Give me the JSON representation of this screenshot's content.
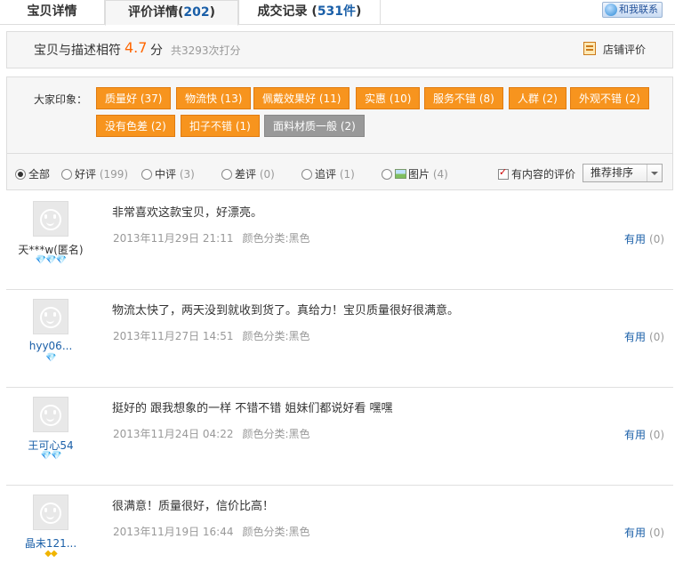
{
  "tabs": [
    {
      "label": "宝贝详情",
      "count": ""
    },
    {
      "label": "评价详情",
      "count": "202"
    },
    {
      "label": "成交记录",
      "count": "531件"
    }
  ],
  "contact_label": "和我联系",
  "rating": {
    "label": "宝贝与描述相符",
    "score": "4.7",
    "unit": "分",
    "count_text": "共3293次打分",
    "shop_review": "店铺评价"
  },
  "impressions": {
    "label": "大家印象：",
    "tags": [
      {
        "text": "质量好 (37)",
        "type": "positive"
      },
      {
        "text": "物流快 (13)",
        "type": "positive"
      },
      {
        "text": "佩戴效果好 (11)",
        "type": "positive"
      },
      {
        "text": "实惠 (10)",
        "type": "positive"
      },
      {
        "text": "服务不错 (8)",
        "type": "positive"
      },
      {
        "text": "人群 (2)",
        "type": "positive"
      },
      {
        "text": "外观不错 (2)",
        "type": "positive"
      },
      {
        "text": "没有色差 (2)",
        "type": "positive"
      },
      {
        "text": "扣子不错 (1)",
        "type": "positive"
      },
      {
        "text": "面料材质一般 (2)",
        "type": "negative"
      }
    ]
  },
  "filters": {
    "options": [
      {
        "label": "全部",
        "count": "",
        "selected": true
      },
      {
        "label": "好评",
        "count": "(199)",
        "selected": false
      },
      {
        "label": "中评",
        "count": "(3)",
        "selected": false
      },
      {
        "label": "差评",
        "count": "(0)",
        "selected": false
      },
      {
        "label": "追评",
        "count": "(1)",
        "selected": false
      },
      {
        "label": "图片",
        "count": "(4)",
        "selected": false
      }
    ],
    "with_content_label": "有内容的评价",
    "with_content_checked": true,
    "sort_label": "推荐排序"
  },
  "reviews": [
    {
      "user": "天***w(匿名)",
      "anonymous": true,
      "badge": "💎💎💎",
      "badge_color": "#e4393c",
      "content": "非常喜欢这款宝贝，好漂亮。",
      "date": "2013年11月29日 21:11",
      "color": "颜色分类:黑色",
      "useful": "有用",
      "useful_count": "(0)"
    },
    {
      "user": "hyy06...",
      "anonymous": false,
      "badge": "💎",
      "badge_color": "#e4393c",
      "content": "物流太快了，两天没到就收到货了。真给力！宝贝质量很好很满意。",
      "date": "2013年11月27日 14:51",
      "color": "颜色分类:黑色",
      "useful": "有用",
      "useful_count": "(0)"
    },
    {
      "user": "王可心54",
      "anonymous": false,
      "badge": "💎💎",
      "badge_color": "#e4393c",
      "content": "挺好的 跟我想象的一样 不错不错 姐妹们都说好看 嘿嘿",
      "date": "2013年11月24日 04:22",
      "color": "颜色分类:黑色",
      "useful": "有用",
      "useful_count": "(0)"
    },
    {
      "user": "晶未121...",
      "anonymous": false,
      "badge": "◆◆",
      "badge_color": "#f0b400",
      "content": "很满意！质量很好，信价比高！",
      "date": "2013年11月19日 16:44",
      "color": "颜色分类:黑色",
      "useful": "有用",
      "useful_count": "(0)"
    }
  ]
}
